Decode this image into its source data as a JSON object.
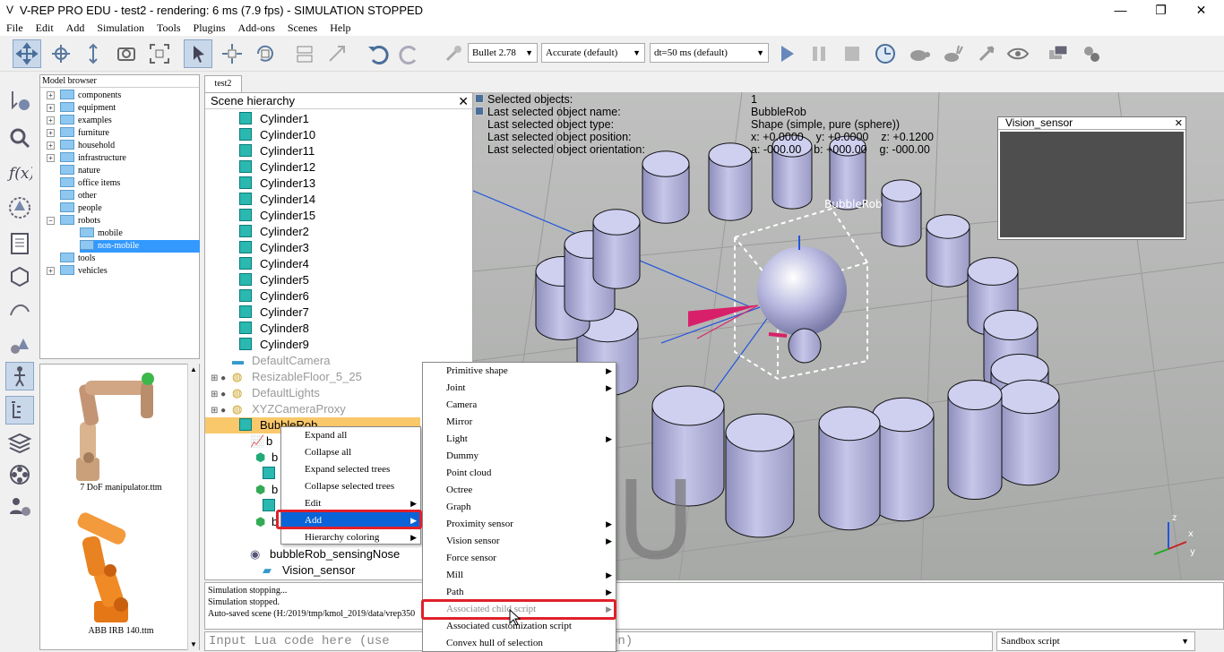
{
  "window": {
    "title": "V-REP PRO EDU - test2 - rendering: 6 ms (7.9 fps) - SIMULATION STOPPED",
    "minimize": "—",
    "restore": "❐",
    "close": "✕"
  },
  "menubar": [
    "File",
    "Edit",
    "Add",
    "Simulation",
    "Tools",
    "Plugins",
    "Add-ons",
    "Scenes",
    "Help"
  ],
  "toolbar": {
    "engine": "Bullet 2.78",
    "accuracy": "Accurate (default)",
    "timestep": "dt=50 ms (default)"
  },
  "model_browser": {
    "title": "Model browser",
    "items": [
      "components",
      "equipment",
      "examples",
      "furniture",
      "household",
      "infrastructure",
      "nature",
      "office items",
      "other",
      "people",
      "robots",
      "mobile",
      "non-mobile",
      "tools",
      "vehicles"
    ],
    "thumbs": [
      "7 DoF manipulator.ttm",
      "ABB IRB 140.ttm"
    ]
  },
  "tabs": [
    "test2"
  ],
  "hierarchy": {
    "title": "Scene hierarchy",
    "cylinders": [
      "Cylinder1",
      "Cylinder10",
      "Cylinder11",
      "Cylinder12",
      "Cylinder13",
      "Cylinder14",
      "Cylinder15",
      "Cylinder2",
      "Cylinder3",
      "Cylinder4",
      "Cylinder5",
      "Cylinder6",
      "Cylinder7",
      "Cylinder8",
      "Cylinder9"
    ],
    "others": [
      "DefaultCamera",
      "ResizableFloor_5_25",
      "DefaultLights",
      "XYZCameraProxy",
      "BubbleRob"
    ],
    "children": [
      "bubbleRob_sensingNose",
      "Vision_sensor"
    ],
    "partial": [
      "b",
      "b",
      "b",
      "b"
    ]
  },
  "info": {
    "labels": [
      "Selected objects:",
      "Last selected object name:",
      "Last selected object type:",
      "Last selected object position:",
      "Last selected object orientation:"
    ],
    "values": [
      "1",
      "BubbleRob",
      "Shape (simple, pure (sphere))",
      "x: +0.0000    y: +0.0000    z: +0.1200",
      "a: -000.00    b: +000.00    g: -000.00"
    ]
  },
  "viewport": {
    "object_label": "BubbleRob",
    "watermark": "U",
    "axes": [
      "z",
      "x",
      "y"
    ]
  },
  "vision_window": {
    "title": "Vision_sensor"
  },
  "context_menu": [
    "Expand all",
    "Collapse all",
    "Expand selected trees",
    "Collapse selected trees",
    "Edit",
    "Add",
    "Hierarchy coloring"
  ],
  "add_menu": [
    "Primitive shape",
    "Joint",
    "Camera",
    "Mirror",
    "Light",
    "Dummy",
    "Point cloud",
    "Octree",
    "Graph",
    "Proximity sensor",
    "Vision sensor",
    "Force sensor",
    "Mill",
    "Path",
    "Associated child script",
    "Associated customization script",
    "Convex hull of selection"
  ],
  "console": [
    "Simulation stopping...",
    "Simulation stopped.",
    "Auto-saved scene (H:/2019/tmp/kmol_2019/data/vrep350"
  ],
  "lua_input": {
    "placeholder": "Input Lua code here (use",
    "tail": "on)"
  },
  "script_selector": "Sandbox script"
}
